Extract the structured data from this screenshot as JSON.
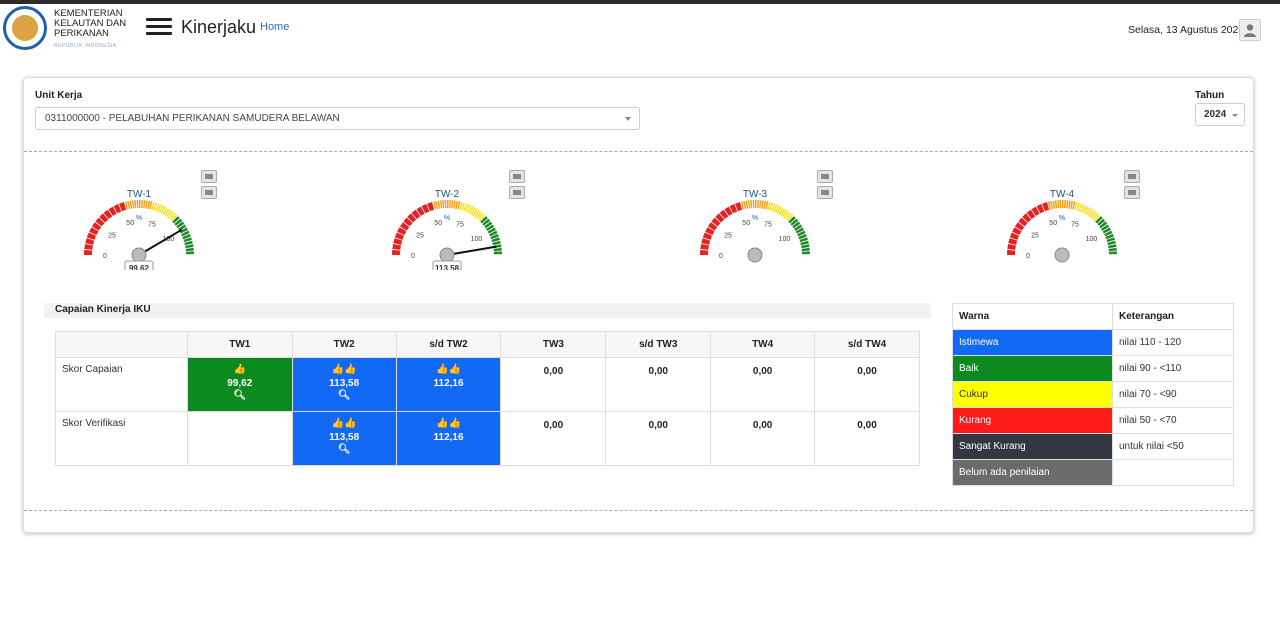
{
  "header": {
    "org_lines": [
      "KEMENTERIAN",
      "KELAUTAN DAN",
      "PERIKANAN"
    ],
    "org_sub": "REPUBLIK INDONESIA",
    "app_title": "Kinerjaku",
    "home_link": "Home",
    "date": "Selasa, 13 Agustus 2024",
    "avatar_icon": "user-icon"
  },
  "filters": {
    "unit_label": "Unit Kerja",
    "unit_value": "0311000000 - PELABUHAN PERIKANAN SAMUDERA BELAWAN",
    "year_label": "Tahun",
    "year_value": "2024"
  },
  "gauges": [
    {
      "title": "TW-1",
      "value_label": "99.62",
      "value": 99.62
    },
    {
      "title": "TW-2",
      "value_label": "113.58",
      "value": 113.58
    },
    {
      "title": "TW-3",
      "value_label": "",
      "value": null
    },
    {
      "title": "TW-4",
      "value_label": "",
      "value": null
    }
  ],
  "gauge_scale": {
    "ticks": [
      "0",
      "25",
      "50",
      "75",
      "100"
    ],
    "unit": "%",
    "max": 120,
    "bands": [
      {
        "from": 0,
        "to": 50,
        "color": "#e32222"
      },
      {
        "from": 50,
        "to": 70,
        "color": "#f39c12"
      },
      {
        "from": 70,
        "to": 90,
        "color": "#f7e01a"
      },
      {
        "from": 90,
        "to": 120,
        "color": "#1e8a27"
      }
    ]
  },
  "iku": {
    "title": "Capaian Kinerja IKU",
    "columns": [
      "",
      "TW1",
      "TW2",
      "s/d TW2",
      "TW3",
      "s/d TW3",
      "TW4",
      "s/d TW4"
    ],
    "rows": [
      {
        "label": "Skor Capaian",
        "cells": [
          {
            "value": "99,62",
            "color": "green",
            "thumbs": "👍",
            "search": true
          },
          {
            "value": "113,58",
            "color": "blue",
            "thumbs": "👍👍",
            "search": true
          },
          {
            "value": "112,16",
            "color": "blue",
            "thumbs": "👍👍",
            "search": false
          },
          {
            "value": "0,00"
          },
          {
            "value": "0,00"
          },
          {
            "value": "0,00"
          },
          {
            "value": "0,00"
          }
        ]
      },
      {
        "label": "Skor Verifikasi",
        "cells": [
          {
            "value": ""
          },
          {
            "value": "113,58",
            "color": "blue",
            "thumbs": "👍👍",
            "search": true
          },
          {
            "value": "112,16",
            "color": "blue",
            "thumbs": "👍👍",
            "search": false
          },
          {
            "value": "0,00"
          },
          {
            "value": "0,00"
          },
          {
            "value": "0,00"
          },
          {
            "value": "0,00"
          }
        ]
      }
    ]
  },
  "legend": {
    "headers": [
      "Warna",
      "Keterangan"
    ],
    "rows": [
      {
        "name": "Istimewa",
        "desc": "nilai 110 - 120",
        "color": "#1269f5",
        "text": "#fff"
      },
      {
        "name": "Baik",
        "desc": "nilai 90 - <110",
        "color": "#0d8a1f",
        "text": "#fff"
      },
      {
        "name": "Cukup",
        "desc": "nilai 70 - <90",
        "color": "#ffff00",
        "text": "#333"
      },
      {
        "name": "Kurang",
        "desc": "nilai 50 - <70",
        "color": "#ff1a1a",
        "text": "#fff"
      },
      {
        "name": "Sangat Kurang",
        "desc": "untuk nilai <50",
        "color": "#333740",
        "text": "#fff"
      },
      {
        "name": "Belum ada penilaian",
        "desc": "",
        "color": "#6b6b6b",
        "text": "#fff"
      }
    ]
  }
}
